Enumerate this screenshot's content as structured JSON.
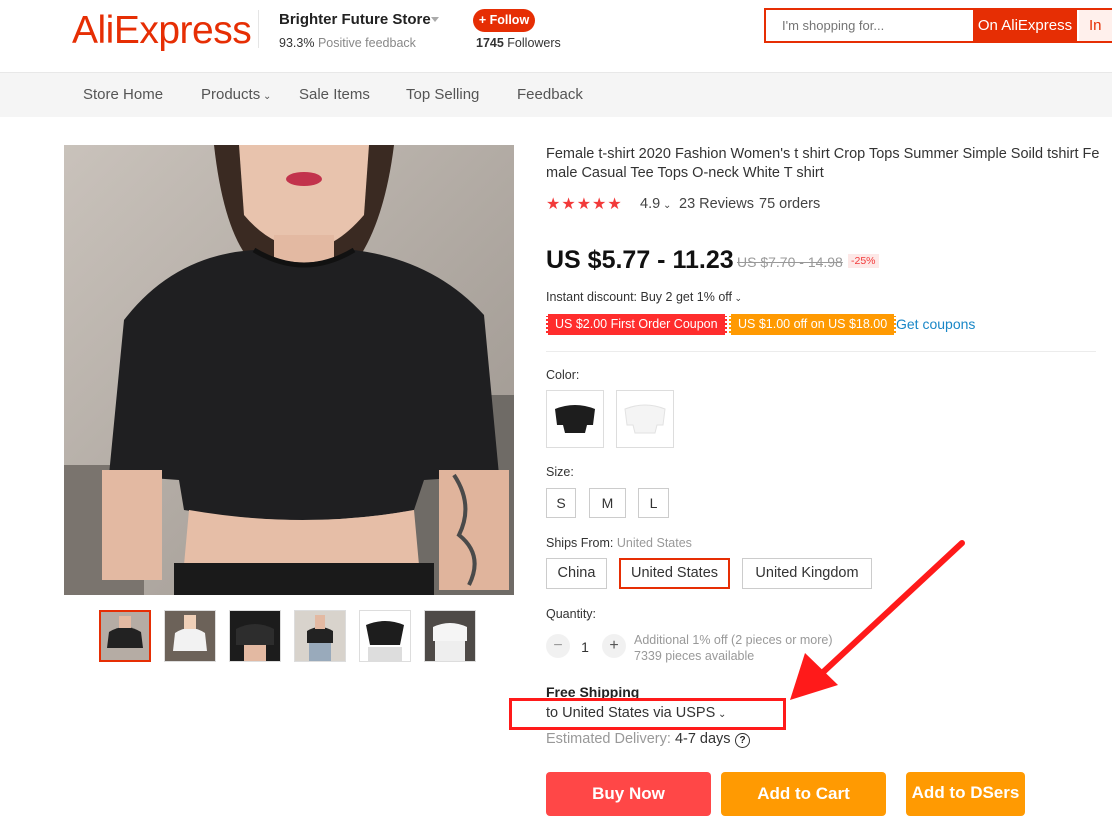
{
  "header": {
    "logo": "AliExpress",
    "store_name": "Brighter Future Store",
    "feedback_pct": "93.3%",
    "feedback_label": "Positive feedback",
    "follow_label": "+ Follow",
    "followers_count": "1745",
    "followers_label": "Followers",
    "search_placeholder": "I'm shopping for...",
    "search_button": "On AliExpress",
    "search_button2": "In"
  },
  "nav": {
    "items": [
      "Store Home",
      "Products",
      "Sale Items",
      "Top Selling",
      "Feedback"
    ]
  },
  "product": {
    "title": "Female t-shirt 2020 Fashion Women's t shirt Crop Tops Summer Simple Soild tshirt Female Casual Tee Tops O-neck White T shirt",
    "stars": "★★★★★",
    "rating": "4.9",
    "reviews": "23 Reviews",
    "orders": "75 orders",
    "price": "US $5.77 - 11.23",
    "old_price": "US $7.70 - 14.98",
    "discount": "-25%",
    "instant_discount": "Instant discount: Buy 2 get 1% off",
    "coupon1": "US $2.00 First Order Coupon",
    "coupon2": "US $1.00 off on US $18.00",
    "get_coupons": "Get coupons",
    "color_label": "Color:",
    "size_label": "Size:",
    "sizes": [
      "S",
      "M",
      "L"
    ],
    "ships_from_label": "Ships From:",
    "ships_from_value": "United States",
    "ship_options": [
      "China",
      "United States",
      "United Kingdom"
    ],
    "quantity_label": "Quantity:",
    "quantity_value": "1",
    "qty_minus": "−",
    "qty_plus": "+",
    "qty_note1": "Additional 1% off (2 pieces or more)",
    "qty_note2": "7339 pieces available",
    "free_shipping": "Free Shipping",
    "ship_to": "to United States via USPS",
    "est_label": "Estimated Delivery:",
    "est_value": "4-7 days",
    "buy_now": "Buy Now",
    "add_to_cart": "Add to Cart",
    "add_to_dsers": "Add to DSers"
  },
  "colors": {
    "accent": "#e62e04",
    "star": "#f23a3a",
    "link": "#1987c7",
    "cart": "#ff9a02",
    "buy": "#ff4747",
    "arrow": "#ff1a1a"
  }
}
